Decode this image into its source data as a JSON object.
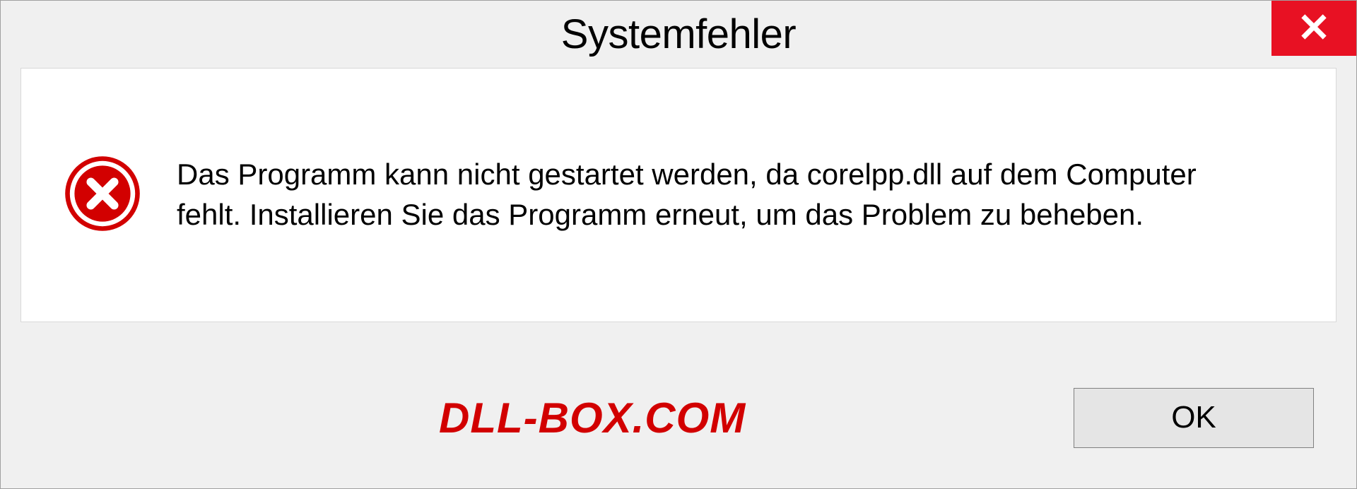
{
  "dialog": {
    "title": "Systemfehler",
    "message": "Das Programm kann nicht gestartet werden, da corelpp.dll auf dem Computer fehlt. Installieren Sie das Programm erneut, um das Problem zu beheben.",
    "ok_label": "OK"
  },
  "watermark": "DLL-BOX.COM"
}
